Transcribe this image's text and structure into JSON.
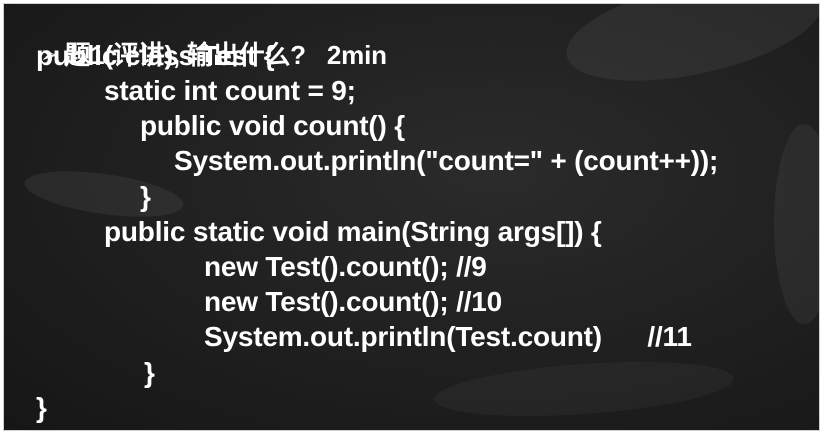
{
  "heading": {
    "bullet": "➢",
    "text": "题1(评讲), 输出什么?   2min"
  },
  "code": [
    "public class Test {",
    "static int count = 9;",
    "public void count() {",
    "System.out.println(\"count=\" + (count++));",
    "}",
    "public static void main(String args[]) {",
    "new Test().count(); //9",
    "new Test().count(); //10",
    "System.out.println(Test.count)      //11",
    "}",
    "}"
  ]
}
